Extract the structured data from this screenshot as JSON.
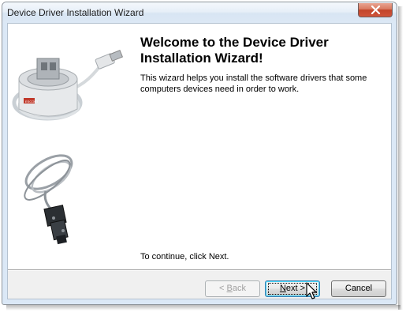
{
  "window": {
    "title": "Device Driver Installation Wizard"
  },
  "wizard": {
    "heading": "Welcome to the Device Driver Installation Wizard!",
    "description": "This wizard helps you install the software drivers that some computers devices need in order to work.",
    "continue_text": "To continue, click Next."
  },
  "buttons": {
    "back": {
      "label_pre": "< ",
      "mnemonic": "B",
      "label_post": "ack",
      "enabled": false
    },
    "next": {
      "label_pre": "",
      "mnemonic": "N",
      "label_post": "ext >",
      "enabled": true,
      "default": true
    },
    "cancel": {
      "label": "Cancel",
      "enabled": true
    }
  },
  "images": {
    "top": "usb-cradle-with-cable",
    "bottom": "serial-db9-cable"
  },
  "icons": {
    "close": "close-icon",
    "cursor": "mouse-pointer"
  },
  "colors": {
    "close_button": "#c2452a",
    "titlebar": "#dce8f5",
    "default_button_border": "#3c7fb1"
  }
}
